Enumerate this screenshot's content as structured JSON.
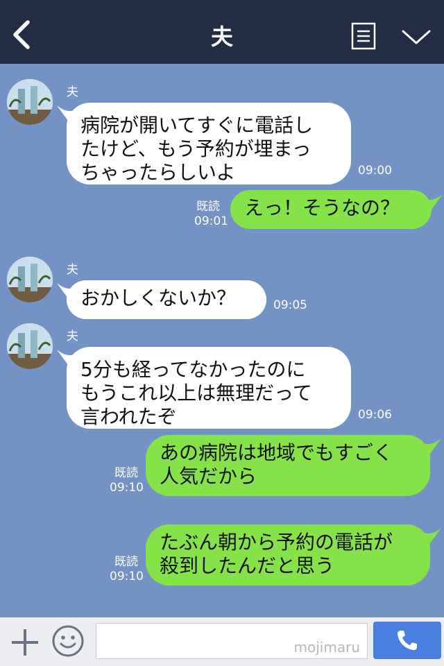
{
  "header": {
    "title": "夫"
  },
  "messages": [
    {
      "direction": "in",
      "sender": "夫",
      "text": "病院が開いてすぐに電話し\nたけど、もう予約が埋まっ\nちゃったらしいよ",
      "time": "09:00"
    },
    {
      "direction": "out",
      "read_label": "既読",
      "text": "えっ！そうなの？",
      "time": "09:01"
    },
    {
      "direction": "in",
      "sender": "夫",
      "text": "おかしくないか？",
      "time": "09:05"
    },
    {
      "direction": "in",
      "sender": "夫",
      "text": "5分も経ってなかったのに\nもうこれ以上は無理だって\n言われたぞ",
      "time": "09:06"
    },
    {
      "direction": "out",
      "read_label": "既読",
      "text": "あの病院は地域でもすごく\n人気だから",
      "time": "09:10"
    },
    {
      "direction": "out",
      "read_label": "既読",
      "text": "たぶん朝から予約の電話が\n殺到したんだと思う",
      "time": "09:10"
    }
  ],
  "footer": {
    "input_value": "",
    "watermark": "mojimaru"
  },
  "colors": {
    "header_bg": "#232d45",
    "chat_bg": "#7393c4",
    "incoming_bubble": "#ffffff",
    "outgoing_bubble": "#85e249",
    "call_button": "#4a7fe0"
  },
  "icons": [
    "back-icon",
    "note-icon",
    "chevron-down-icon",
    "plus-icon",
    "emoji-icon",
    "phone-icon"
  ]
}
